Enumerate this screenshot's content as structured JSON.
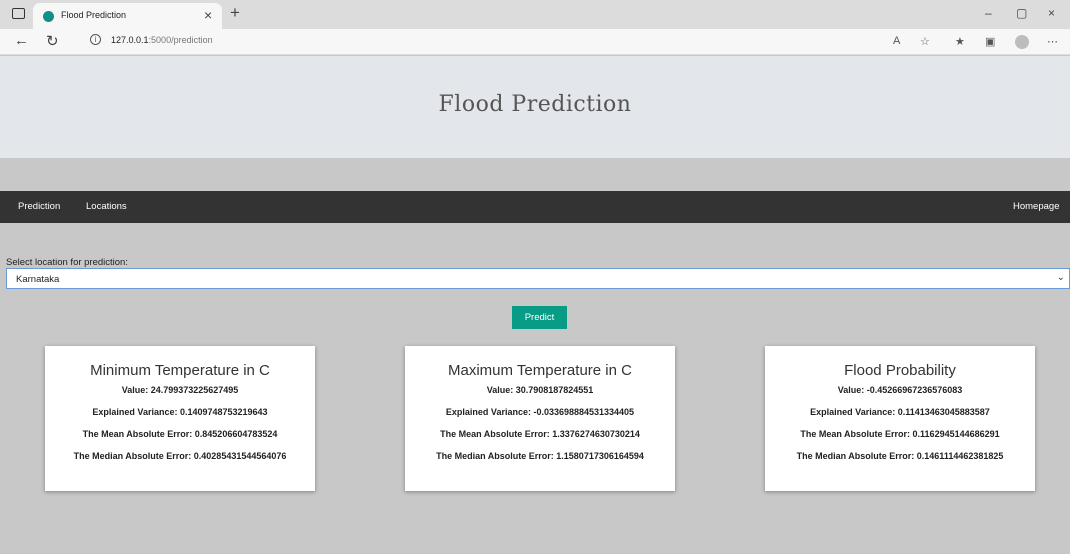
{
  "browser": {
    "tab_title": "Flood Prediction",
    "tab_close": "×",
    "new_tab": "+",
    "url_host": "127.0.0.1",
    "url_rest": ":5000/prediction",
    "controls": {
      "minimize": "–",
      "restore": "▢",
      "close": "×"
    }
  },
  "page": {
    "title": "Flood Prediction",
    "nav": {
      "prediction": "Prediction",
      "locations": "Locations",
      "homepage": "Homepage"
    },
    "select": {
      "label": "Select location for prediction:",
      "value": "Karnataka"
    },
    "predict_label": "Predict"
  },
  "cards": [
    {
      "title": "Minimum Temperature in C",
      "value": "Value: 24.799373225627495",
      "explained_variance": "Explained Variance: 0.1409748753219643",
      "mean_abs_error": "The Mean Absolute Error: 0.845206604783524",
      "median_abs_error": "The Median Absolute Error: 0.40285431544564076"
    },
    {
      "title": "Maximum Temperature in C",
      "value": "Value: 30.7908187824551",
      "explained_variance": "Explained Variance: -0.033698884531334405",
      "mean_abs_error": "The Mean Absolute Error: 1.3376274630730214",
      "median_abs_error": "The Median Absolute Error: 1.1580717306164594"
    },
    {
      "title": "Flood Probability",
      "value": "Value: -0.45266967236576083",
      "explained_variance": "Explained Variance: 0.11413463045883587",
      "mean_abs_error": "The Mean Absolute Error: 0.1162945144686291",
      "median_abs_error": "The Median Absolute Error: 0.1461114462381825"
    }
  ]
}
